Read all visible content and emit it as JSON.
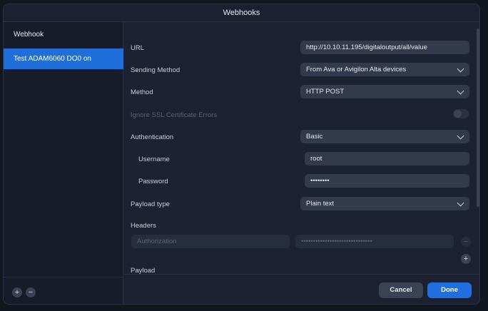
{
  "dialog": {
    "title": "Webhooks"
  },
  "sidebar": {
    "header": "Webhook",
    "items": [
      {
        "label": "Test ADAM6060 DO0 on"
      }
    ],
    "add_icon": "+",
    "remove_icon": "−"
  },
  "form": {
    "url_label": "URL",
    "url_value": "http://10.10.11.195/digitaloutput/all/value",
    "sending_method_label": "Sending Method",
    "sending_method_value": "From Ava or Avigilon Alta devices",
    "method_label": "Method",
    "method_value": "HTTP POST",
    "ignore_ssl_label": "Ignore SSL Certificate Errors",
    "authentication_label": "Authentication",
    "authentication_value": "Basic",
    "username_label": "Username",
    "username_value": "root",
    "password_label": "Password",
    "password_value": "••••••••",
    "payload_type_label": "Payload type",
    "payload_type_value": "Plain text",
    "headers_label": "Headers",
    "header_key_placeholder": "Authorization",
    "header_value_placeholder": "••••••••••••••••••••••••••••••",
    "payload_label": "Payload",
    "add_header_icon": "+",
    "remove_header_icon": "−"
  },
  "footer": {
    "cancel_label": "Cancel",
    "done_label": "Done"
  },
  "colors": {
    "accent": "#1f6fe0",
    "panel": "#1c2231",
    "field": "#323a4b"
  }
}
